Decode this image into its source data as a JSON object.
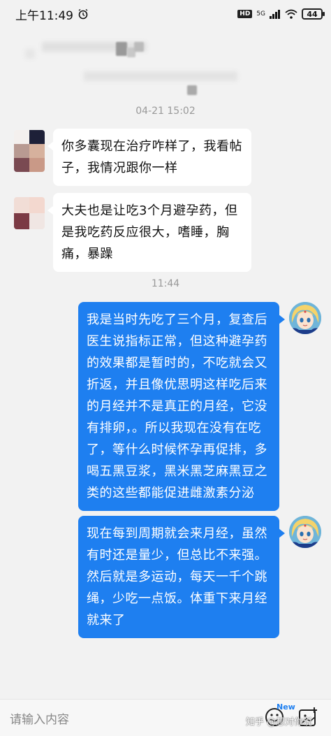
{
  "status_bar": {
    "time": "上午11:49",
    "hd": "HD",
    "network": "5G",
    "battery": "44"
  },
  "conversation": {
    "timestamp_1": "04-21 15:02",
    "timestamp_2": "11:44",
    "messages": [
      {
        "sender": "other",
        "lines": [
          "你多囊现在治疗咋样了，我看帖",
          "子，我情况跟你一样"
        ]
      },
      {
        "sender": "other",
        "lines": [
          "大夫也是让吃3个月避孕药，但",
          "是我吃药反应很大，嗜睡，胸",
          "痛，暴躁"
        ]
      },
      {
        "sender": "self",
        "lines": [
          "我是当时先吃了三个月，复查后",
          "医生说指标正常，但这种避孕药",
          "的效果都是暂时的，不吃就会又",
          "折返，并且像优思明这样吃后来",
          "的月经并不是真正的月经，它没",
          "有排卵，。所以我现在没有在吃",
          "了，等什么时候怀孕再促排，多",
          "喝五黑豆浆，黑米黑芝麻黑豆之",
          "类的这些都能促进雌激素分泌"
        ]
      },
      {
        "sender": "self",
        "lines": [
          "现在每到周期就会来月经，虽然",
          "有时还是量少，但总比不来强。",
          "然后就是多运动，每天一千个跳",
          "绳，少吃一点饭。体重下来月经",
          "就来了"
        ]
      }
    ]
  },
  "input_bar": {
    "placeholder": "请输入内容",
    "new_badge": "New",
    "watermark": "知乎 @想对你说"
  },
  "colors": {
    "self_bubble": "#1e7ff0",
    "other_bubble": "#ffffff",
    "background": "#f2f2f2"
  }
}
